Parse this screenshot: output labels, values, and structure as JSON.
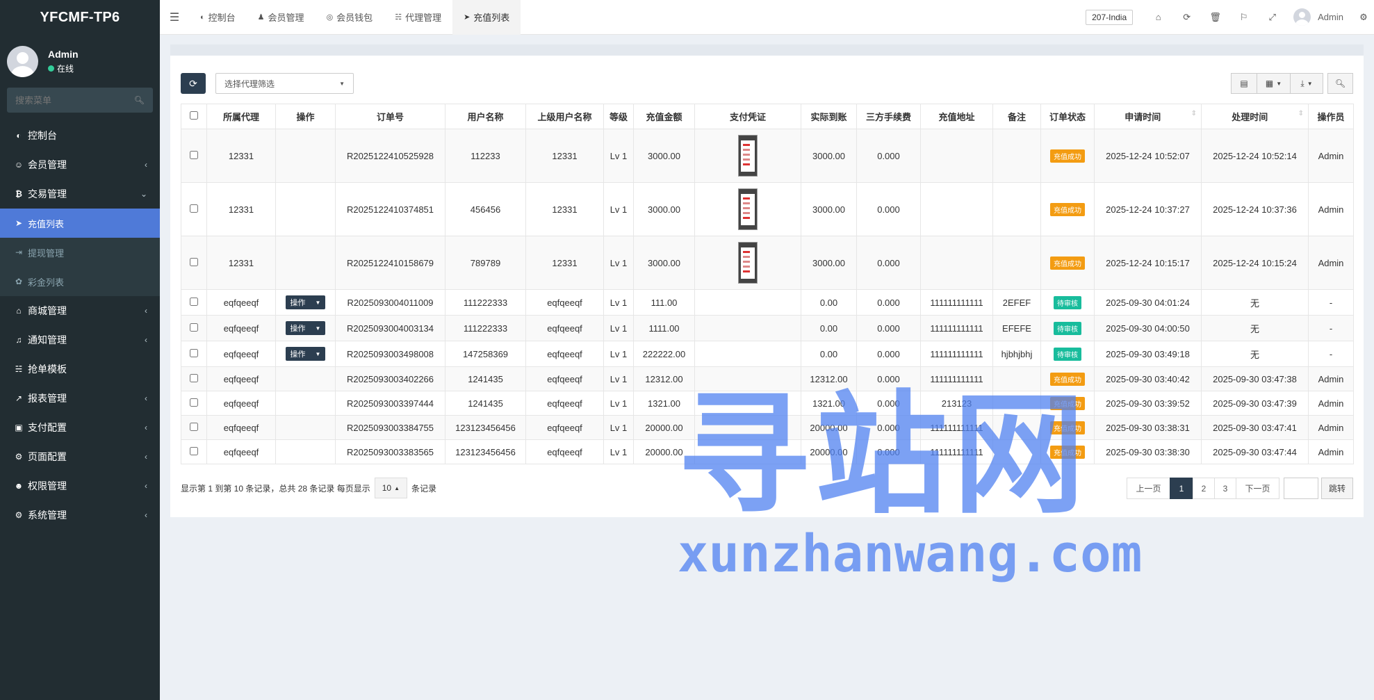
{
  "app": {
    "logo": "YFCMF-TP6"
  },
  "user": {
    "name": "Admin",
    "status": "在线"
  },
  "sidebar": {
    "search_placeholder": "搜索菜单",
    "items": [
      {
        "label": "控制台",
        "icon": "dashboard-icon"
      },
      {
        "label": "会员管理",
        "icon": "user-circle-icon"
      },
      {
        "label": "交易管理",
        "icon": "bitcoin-icon"
      },
      {
        "label": "充值列表",
        "icon": "sign-in-icon"
      },
      {
        "label": "提现管理",
        "icon": "sign-out-icon"
      },
      {
        "label": "彩金列表",
        "icon": "gift-icon"
      },
      {
        "label": "商城管理",
        "icon": "home-icon"
      },
      {
        "label": "通知管理",
        "icon": "bell-icon"
      },
      {
        "label": "抢单模板",
        "icon": "sitemap-icon"
      },
      {
        "label": "报表管理",
        "icon": "line-chart-icon"
      },
      {
        "label": "支付配置",
        "icon": "credit-card-icon"
      },
      {
        "label": "页面配置",
        "icon": "cog-icon"
      },
      {
        "label": "权限管理",
        "icon": "users-icon"
      },
      {
        "label": "系统管理",
        "icon": "cogs-icon"
      }
    ]
  },
  "header": {
    "tabs": [
      {
        "label": "控制台",
        "icon": "dashboard-icon"
      },
      {
        "label": "会员管理",
        "icon": "user-icon"
      },
      {
        "label": "会员钱包",
        "icon": "wallet-icon"
      },
      {
        "label": "代理管理",
        "icon": "sitemap-icon"
      },
      {
        "label": "充值列表",
        "icon": "sign-in-icon"
      }
    ],
    "language": "207-India",
    "user": "Admin"
  },
  "toolbar": {
    "agent_filter_placeholder": "选择代理筛选"
  },
  "table": {
    "columns": [
      "所属代理",
      "操作",
      "订单号",
      "用户名称",
      "上级用户名称",
      "等级",
      "充值金额",
      "支付凭证",
      "实际到账",
      "三方手续费",
      "充值地址",
      "备注",
      "订单状态",
      "申请时间",
      "处理时间",
      "操作员"
    ],
    "op_label": "操作",
    "rows": [
      {
        "agent": "12331",
        "op": false,
        "order": "R2025122410525928",
        "username": "112233",
        "parent": "12331",
        "level": "Lv 1",
        "amount": "3000.00",
        "proof": true,
        "actual": "3000.00",
        "fee": "0.000",
        "address": "",
        "remark": "",
        "status": "充值成功",
        "status_type": "success",
        "apply_time": "2025-12-24 10:52:07",
        "process_time": "2025-12-24 10:52:14",
        "operator": "Admin",
        "h": "tall"
      },
      {
        "agent": "12331",
        "op": false,
        "order": "R2025122410374851",
        "username": "456456",
        "parent": "12331",
        "level": "Lv 1",
        "amount": "3000.00",
        "proof": true,
        "actual": "3000.00",
        "fee": "0.000",
        "address": "",
        "remark": "",
        "status": "充值成功",
        "status_type": "success",
        "apply_time": "2025-12-24 10:37:27",
        "process_time": "2025-12-24 10:37:36",
        "operator": "Admin",
        "h": "tall"
      },
      {
        "agent": "12331",
        "op": false,
        "order": "R2025122410158679",
        "username": "789789",
        "parent": "12331",
        "level": "Lv 1",
        "amount": "3000.00",
        "proof": true,
        "actual": "3000.00",
        "fee": "0.000",
        "address": "",
        "remark": "",
        "status": "充值成功",
        "status_type": "success",
        "apply_time": "2025-12-24 10:15:17",
        "process_time": "2025-12-24 10:15:24",
        "operator": "Admin",
        "h": "tall"
      },
      {
        "agent": "eqfqeeqf",
        "op": true,
        "order": "R2025093004011009",
        "username": "111222333",
        "parent": "eqfqeeqf",
        "level": "Lv 1",
        "amount": "111.00",
        "proof": false,
        "actual": "0.00",
        "fee": "0.000",
        "address": "111111111111",
        "remark": "2EFEF",
        "status": "待审核",
        "status_type": "pending",
        "apply_time": "2025-09-30 04:01:24",
        "process_time": "无",
        "operator": "-",
        "h": "mid"
      },
      {
        "agent": "eqfqeeqf",
        "op": true,
        "order": "R2025093004003134",
        "username": "111222333",
        "parent": "eqfqeeqf",
        "level": "Lv 1",
        "amount": "1111.00",
        "proof": false,
        "actual": "0.00",
        "fee": "0.000",
        "address": "111111111111",
        "remark": "EFEFE",
        "status": "待审核",
        "status_type": "pending",
        "apply_time": "2025-09-30 04:00:50",
        "process_time": "无",
        "operator": "-",
        "h": "mid"
      },
      {
        "agent": "eqfqeeqf",
        "op": true,
        "order": "R2025093003498008",
        "username": "147258369",
        "parent": "eqfqeeqf",
        "level": "Lv 1",
        "amount": "222222.00",
        "proof": false,
        "actual": "0.00",
        "fee": "0.000",
        "address": "111111111111",
        "remark": "hjbhjbhj",
        "status": "待审核",
        "status_type": "pending",
        "apply_time": "2025-09-30 03:49:18",
        "process_time": "无",
        "operator": "-",
        "h": "mid"
      },
      {
        "agent": "eqfqeeqf",
        "op": false,
        "order": "R2025093003402266",
        "username": "1241435",
        "parent": "eqfqeeqf",
        "level": "Lv 1",
        "amount": "12312.00",
        "proof": false,
        "actual": "12312.00",
        "fee": "0.000",
        "address": "111111111111",
        "remark": "",
        "status": "充值成功",
        "status_type": "success",
        "apply_time": "2025-09-30 03:40:42",
        "process_time": "2025-09-30 03:47:38",
        "operator": "Admin",
        "h": "short"
      },
      {
        "agent": "eqfqeeqf",
        "op": false,
        "order": "R2025093003397444",
        "username": "1241435",
        "parent": "eqfqeeqf",
        "level": "Lv 1",
        "amount": "1321.00",
        "proof": false,
        "actual": "1321.00",
        "fee": "0.000",
        "address": "213123",
        "remark": "",
        "status": "充值成功",
        "status_type": "success",
        "apply_time": "2025-09-30 03:39:52",
        "process_time": "2025-09-30 03:47:39",
        "operator": "Admin",
        "h": "short"
      },
      {
        "agent": "eqfqeeqf",
        "op": false,
        "order": "R2025093003384755",
        "username": "123123456456",
        "parent": "eqfqeeqf",
        "level": "Lv 1",
        "amount": "20000.00",
        "proof": false,
        "actual": "20000.00",
        "fee": "0.000",
        "address": "111111111111",
        "remark": "",
        "status": "充值成功",
        "status_type": "success",
        "apply_time": "2025-09-30 03:38:31",
        "process_time": "2025-09-30 03:47:41",
        "operator": "Admin",
        "h": "short"
      },
      {
        "agent": "eqfqeeqf",
        "op": false,
        "order": "R2025093003383565",
        "username": "123123456456",
        "parent": "eqfqeeqf",
        "level": "Lv 1",
        "amount": "20000.00",
        "proof": false,
        "actual": "20000.00",
        "fee": "0.000",
        "address": "111111111111",
        "remark": "",
        "status": "充值成功",
        "status_type": "success",
        "apply_time": "2025-09-30 03:38:30",
        "process_time": "2025-09-30 03:47:44",
        "operator": "Admin",
        "h": "short"
      }
    ]
  },
  "pagination": {
    "summary_prefix": "显示第 1 到第 10 条记录，总共 28 条记录 每页显示",
    "page_size": "10",
    "summary_suffix": "条记录",
    "prev": "上一页",
    "pages": [
      "1",
      "2",
      "3"
    ],
    "next": "下一页",
    "jump": "跳转"
  },
  "watermark": {
    "cn": "寻站网",
    "en": "xunzhanwang.com"
  },
  "colors": {
    "sidebar_bg": "#222d32",
    "active": "#4f7ad8",
    "primary": "#2c3e50",
    "success_badge": "#f39c12",
    "pending_badge": "#18bc9c"
  }
}
